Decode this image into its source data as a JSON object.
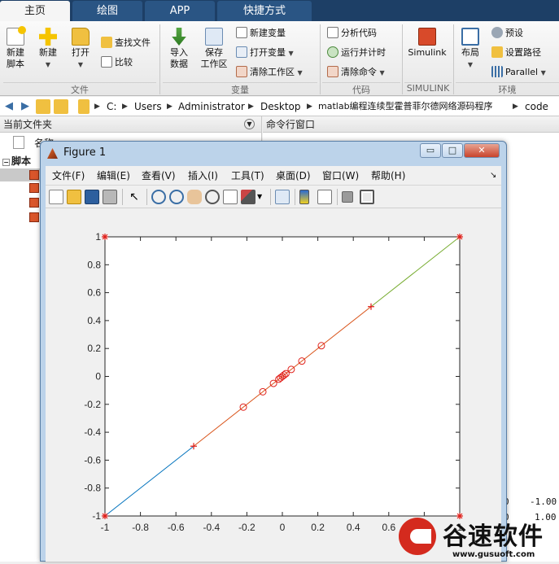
{
  "tabs": [
    "主页",
    "绘图",
    "APP",
    "快捷方式"
  ],
  "ribbon": {
    "file": {
      "new_script": "新建\n脚本",
      "new": "新建",
      "open": "打开",
      "find_files": "查找文件",
      "compare": "比较",
      "group": "文件"
    },
    "variable": {
      "import_data": "导入\n数据",
      "save_workspace": "保存\n工作区",
      "new_variable": "新建变量",
      "open_variable": "打开变量",
      "clear_workspace": "清除工作区",
      "group": "变量"
    },
    "code": {
      "analyze_code": "分析代码",
      "run_and_time": "运行并计时",
      "clear_commands": "清除命令",
      "group": "代码"
    },
    "simulink": {
      "label": "Simulink",
      "group": "SIMULINK"
    },
    "environment": {
      "layout": "布局",
      "preferences": "预设",
      "set_path": "设置路径",
      "parallel": "Parallel",
      "group": "环境"
    }
  },
  "path": [
    "C:",
    "Users",
    "Administrator",
    "Desktop",
    "matlab编程连续型霍普菲尔德网络源码程序",
    "code"
  ],
  "panels": {
    "current_folder": "当前文件夹",
    "name_col": "名称",
    "scripts_group": "脚本",
    "command_window": "命令行窗口"
  },
  "command_values": [
    "0",
    "-1.00",
    "0",
    "1.00"
  ],
  "figure": {
    "title": "Figure 1",
    "menu": [
      "文件(F)",
      "编辑(E)",
      "查看(V)",
      "插入(I)",
      "工具(T)",
      "桌面(D)",
      "窗口(W)",
      "帮助(H)"
    ],
    "window_buttons": {
      "minimize": "▭",
      "maximize": "□",
      "close": "✕"
    }
  },
  "watermark": {
    "brand": "谷速软件",
    "url": "www.gusuoft.com"
  },
  "colors": {
    "blue_line": "#0072bd",
    "orange_line": "#d95319",
    "green_line": "#77ac30",
    "marker_red": "#e0201b",
    "tab_bar": "#1d3f66"
  },
  "chart_data": {
    "type": "line",
    "title": "",
    "xlabel": "",
    "ylabel": "",
    "xlim": [
      -1,
      1
    ],
    "ylim": [
      -1,
      1
    ],
    "xticks": [
      -1,
      -0.8,
      -0.6,
      -0.4,
      -0.2,
      0,
      0.2,
      0.4,
      0.6,
      0.8,
      1
    ],
    "yticks": [
      -1,
      -0.8,
      -0.6,
      -0.4,
      -0.2,
      0,
      0.2,
      0.4,
      0.6,
      0.8,
      1
    ],
    "grid": false,
    "series": [
      {
        "color": "#0072bd",
        "x": [
          -1,
          -0.5
        ],
        "y": [
          -1,
          -0.5
        ]
      },
      {
        "color": "#d95319",
        "x": [
          -0.5,
          0
        ],
        "y": [
          -0.5,
          0
        ]
      },
      {
        "color": "#d95319",
        "x": [
          0,
          0.5
        ],
        "y": [
          0,
          0.5
        ]
      },
      {
        "color": "#77ac30",
        "x": [
          0.5,
          1
        ],
        "y": [
          0.5,
          1
        ]
      }
    ],
    "plus_markers": {
      "x": [
        -0.5,
        0.5
      ],
      "y": [
        -0.5,
        0.5
      ]
    },
    "star_markers": {
      "x": [
        -1,
        1,
        -1,
        1
      ],
      "y": [
        1,
        1,
        -1,
        -1
      ]
    },
    "circle_markers": {
      "x": [
        -0.22,
        -0.11,
        -0.05,
        -0.02,
        -0.01,
        0.0,
        0.01,
        0.02,
        0.05,
        0.11,
        0.22
      ],
      "y": [
        -0.22,
        -0.11,
        -0.05,
        -0.02,
        -0.01,
        0.0,
        0.01,
        0.02,
        0.05,
        0.11,
        0.22
      ]
    }
  }
}
